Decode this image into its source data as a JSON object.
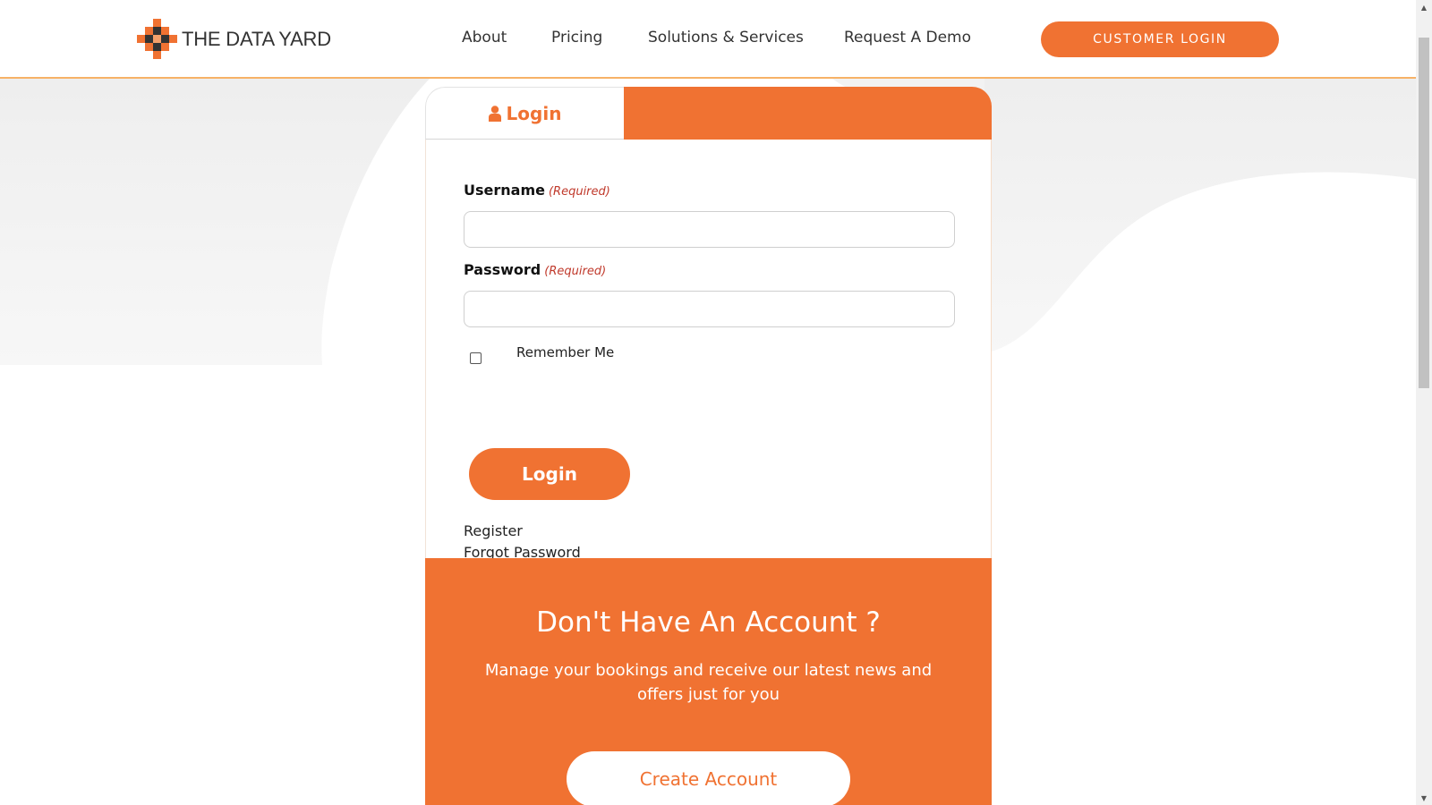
{
  "brand": {
    "name": "THE DATA YARD",
    "accent_color": "#f07232",
    "dark_color": "#333333"
  },
  "nav": {
    "items": [
      {
        "label": "About"
      },
      {
        "label": "Pricing"
      },
      {
        "label": "Solutions & Services"
      },
      {
        "label": "Request A Demo"
      }
    ],
    "cta_label": "CUSTOMER LOGIN"
  },
  "login_card": {
    "tab_label": "Login",
    "tab_icon": "user-icon",
    "username_label": "Username",
    "password_label": "Password",
    "required_text": "(Required)",
    "username_value": "",
    "password_value": "",
    "remember_label": "Remember Me",
    "remember_checked": false,
    "submit_label": "Login",
    "register_link": "Register",
    "forgot_link": "Forgot Password"
  },
  "signup": {
    "title": "Don't Have An Account ?",
    "text": "Manage your bookings and receive our latest news and offers just for you",
    "button_label": "Create Account"
  }
}
